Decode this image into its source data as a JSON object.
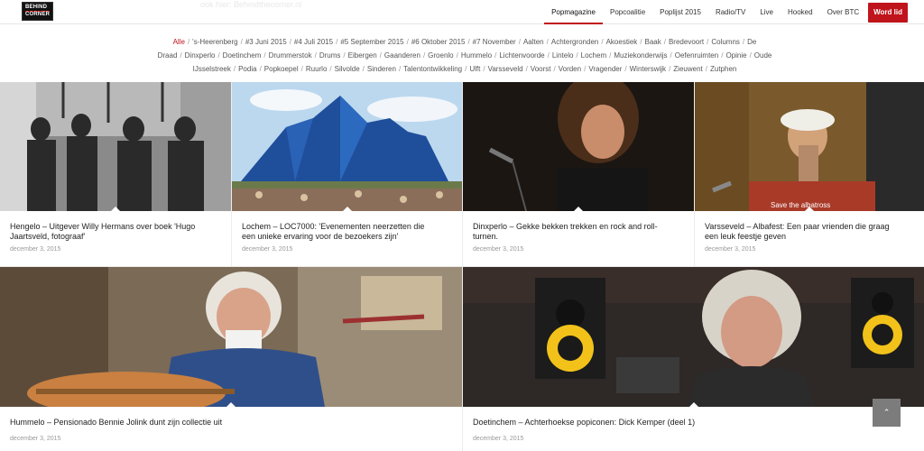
{
  "header": {
    "logo_line1": "BEHIND",
    "logo_line2": "CORNER",
    "ghost": "ook hier: Behindthecorner.nl",
    "nav": [
      {
        "label": "Popmagazine",
        "active": true
      },
      {
        "label": "Popcoalitie"
      },
      {
        "label": "Poplijst 2015"
      },
      {
        "label": "Radio/TV"
      },
      {
        "label": "Live"
      },
      {
        "label": "Hooked"
      },
      {
        "label": "Over BTC"
      }
    ],
    "cta": "Word lid"
  },
  "tags": [
    "Alle",
    "'s-Heerenberg",
    "#3 Juni 2015",
    "#4 Juli 2015",
    "#5 September 2015",
    "#6 Oktober 2015",
    "#7 November",
    "Aalten",
    "Achtergronden",
    "Akoestiek",
    "Baak",
    "Bredevoort",
    "Columns",
    "De Draad",
    "Dinxperlo",
    "Doetinchem",
    "Drummerstok",
    "Drums",
    "Eibergen",
    "Gaanderen",
    "Groenlo",
    "Hummelo",
    "Lichtenvoorde",
    "Lintelo",
    "Lochem",
    "Muziekonderwijs",
    "Oefenruimten",
    "Opinie",
    "Oude IJsselstreek",
    "Podia",
    "Popkoepel",
    "Ruurlo",
    "Silvolde",
    "Sinderen",
    "Talentontwikkeling",
    "Ulft",
    "Varsseveld",
    "Voorst",
    "Vorden",
    "Vragender",
    "Winterswijk",
    "Zieuwent",
    "Zutphen"
  ],
  "articles": [
    {
      "title_line1": "Hengelo – Uitgever Willy Hermans over boek 'Hugo",
      "title_line2": "Jaartsveld, fotograaf'",
      "date": "december 3, 2015"
    },
    {
      "title_line1": "Lochem – LOC7000: 'Evenementen neerzetten die",
      "title_line2": "een unieke ervaring voor de bezoekers zijn'",
      "date": "december 3, 2015"
    },
    {
      "title_line1": "Dinxperlo – Gekke bekken trekken en rock and roll-",
      "title_line2": "turnen.",
      "date": "december 3, 2015"
    },
    {
      "title_line1": "Varsseveld – Albafest: Een paar vrienden die graag",
      "title_line2": "een leuk feestje geven",
      "date": "december 3, 2015"
    },
    {
      "title_line1": "Hummelo – Pensionado Bennie Jolink dunt zijn collectie uit",
      "title_line2": "",
      "date": "december 3, 2015"
    },
    {
      "title_line1": "Doetinchem – Achterhoekse popiconen: Dick Kemper (deel 1)",
      "title_line2": "",
      "date": "december 3, 2015"
    }
  ],
  "photo4_sign": "Save the albatross",
  "totop": "⌃"
}
